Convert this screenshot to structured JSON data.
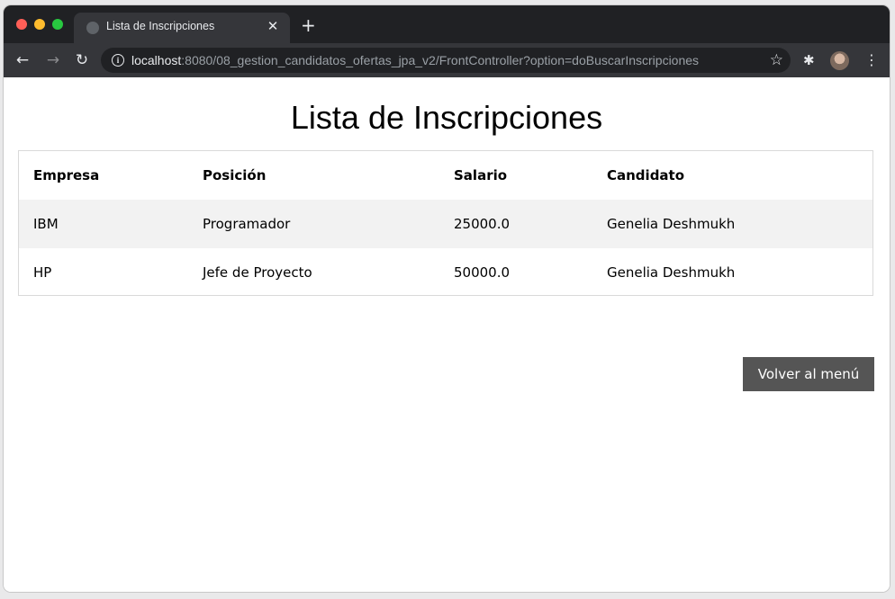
{
  "browser": {
    "tab_title": "Lista de Inscripciones",
    "tab_close": "✕",
    "new_tab": "+",
    "url_host": "localhost",
    "url_rest": ":8080/08_gestion_candidatos_ofertas_jpa_v2/FrontController?option=doBuscarInscripciones"
  },
  "page": {
    "title": "Lista de Inscripciones",
    "table": {
      "headers": [
        "Empresa",
        "Posición",
        "Salario",
        "Candidato"
      ],
      "rows": [
        [
          "IBM",
          "Programador",
          "25000.0",
          "Genelia Deshmukh"
        ],
        [
          "HP",
          "Jefe de Proyecto",
          "50000.0",
          "Genelia Deshmukh"
        ]
      ]
    },
    "back_button": "Volver al menú"
  },
  "colors": {
    "title_bar": "#202124",
    "toolbar": "#35363a",
    "row_alt": "#f2f2f2",
    "button_bg": "#555555"
  },
  "icons": [
    "close-icon",
    "plus-icon",
    "back-arrow-icon",
    "forward-arrow-icon",
    "reload-icon",
    "info-icon",
    "star-icon",
    "puzzle-icon",
    "avatar",
    "more-menu-icon"
  ]
}
